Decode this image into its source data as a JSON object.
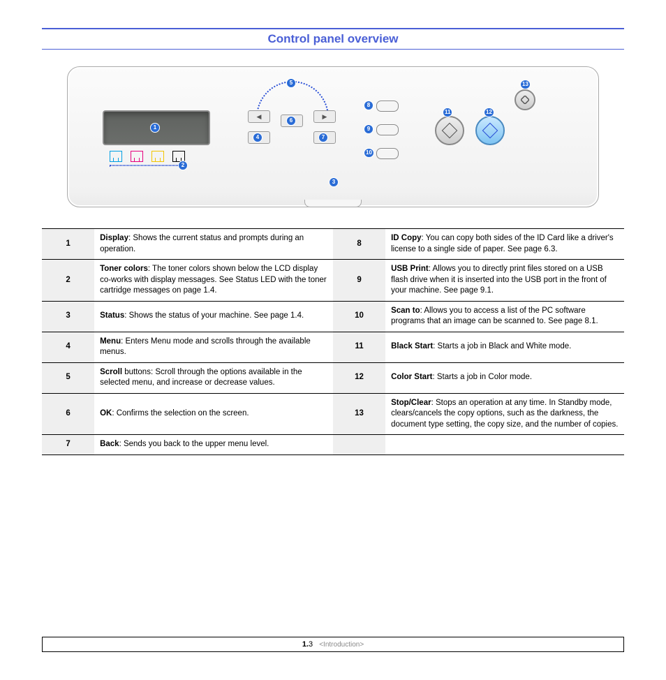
{
  "title": "Control panel overview",
  "callouts": [
    "1",
    "2",
    "3",
    "4",
    "5",
    "6",
    "7",
    "8",
    "9",
    "10",
    "11",
    "12",
    "13"
  ],
  "table": {
    "left": [
      {
        "n": "1",
        "bold": "Display",
        "text": ": Shows the current status and prompts during an operation."
      },
      {
        "n": "2",
        "bold": "Toner colors",
        "text": ": The toner colors shown below the LCD display co-works with display messages.  See Status LED with the toner cartridge messages on page 1.4."
      },
      {
        "n": "3",
        "bold": "Status",
        "text": ": Shows the status of your machine. See page 1.4."
      },
      {
        "n": "4",
        "bold": "Menu",
        "text": ": Enters Menu mode and scrolls through the available menus."
      },
      {
        "n": "5",
        "bold": "Scroll",
        "text": " buttons: Scroll through the options available in the selected menu, and increase or decrease values."
      },
      {
        "n": "6",
        "bold": "OK",
        "text": ": Confirms the selection on the screen."
      },
      {
        "n": "7",
        "bold": "Back",
        "text": ": Sends you back to the upper menu level."
      }
    ],
    "right": [
      {
        "n": "8",
        "bold": "ID Copy",
        "text": ": You can copy both sides of the ID Card like a driver's license to a single side of paper. See page 6.3."
      },
      {
        "n": "9",
        "bold": "USB Print",
        "text": ": Allows you to directly print files stored on a USB flash drive when it is inserted into the USB port in the front of your machine. See page 9.1."
      },
      {
        "n": "10",
        "bold": "Scan to",
        "text": ": Allows you to access a list of the PC software programs that an image can be scanned to. See page 8.1."
      },
      {
        "n": "11",
        "bold": "Black Start",
        "text": ": Starts a job in Black and White mode."
      },
      {
        "n": "12",
        "bold": "Color Start",
        "text": ": Starts a job in Color mode."
      },
      {
        "n": "13",
        "bold": "Stop/Clear",
        "text": ": Stops an operation at any time. In Standby mode, clears/cancels the copy options, such as the darkness, the document type setting, the copy size, and the number of copies."
      },
      {
        "n": "",
        "bold": "",
        "text": ""
      }
    ]
  },
  "footer": {
    "page": "1.",
    "sub": "3",
    "section": "<Introduction>"
  }
}
